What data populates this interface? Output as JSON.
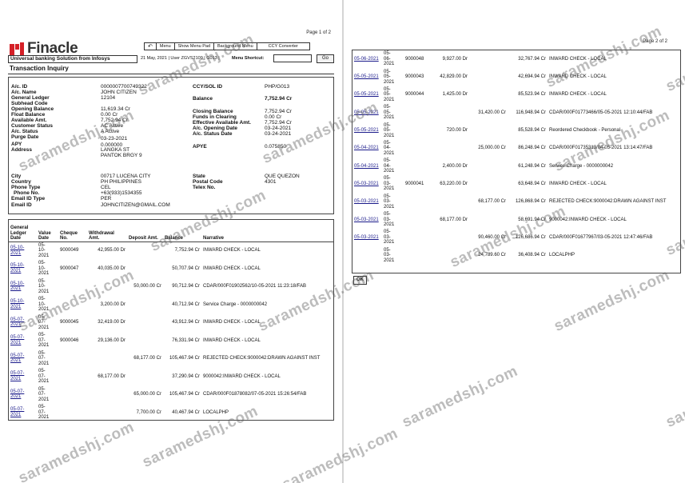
{
  "page1": {
    "page_number": "Page 1 of 2",
    "brand": "Finacle",
    "menu": [
      "Menu",
      "Show Menu Pad",
      "Background Menu",
      "CCY Converter"
    ],
    "menu_icon": "menu-pad-icon",
    "ubs_title": "Universal banking Solution from Infosys",
    "info_bar": "21 May, 2021 | User ZGVS2109 | G013 |",
    "shortcut_label": "Menu Shortcut:",
    "go_label": "Go",
    "page_title": "Transaction Inquiry",
    "account": {
      "left": [
        {
          "label": "A/c. ID",
          "value": "0000007700749322"
        },
        {
          "label": "A/c. Name",
          "value": "JOHN CITIZEN"
        },
        {
          "label": "General Ledger",
          "value": "12104"
        },
        {
          "label": "Subhead Code",
          "value": ""
        },
        {
          "label": "Opening Balance",
          "value": "11,619.34 Cr"
        },
        {
          "label": "Float Balance",
          "value": "0.00 Cr"
        },
        {
          "label": "Available Amt.",
          "value": "7,752.94 Cr"
        },
        {
          "label": "Customer Status",
          "value": "AC Active"
        },
        {
          "label": "A/c. Status",
          "value": "A Active"
        },
        {
          "label": "Purge Date",
          "value": "03-23-2021"
        },
        {
          "label": "APY",
          "value": "0.000000"
        },
        {
          "label": "Address",
          "value": "LANGKA ST"
        },
        {
          "label": "",
          "value": "PANTOK BRGY 9"
        }
      ],
      "right": [
        {
          "label": "CCY/SOL ID",
          "value": "PHP/G013"
        },
        {
          "label": "Balance",
          "value": "7,752.94 Cr"
        },
        {
          "label": "Closing Balance",
          "value": "7,752.94 Cr"
        },
        {
          "label": "Funds in Clearing",
          "value": "0.00 Cr"
        },
        {
          "label": "Effective Available Amt.",
          "value": "7,752.94 Cr"
        },
        {
          "label": "A/c. Opening Date",
          "value": "03-24-2021"
        },
        {
          "label": "A/c. Status Date",
          "value": "03-24-2021"
        },
        {
          "label": "APYE",
          "value": "0.075850"
        }
      ],
      "bottom_left": [
        {
          "label": "City",
          "value": "00717 LUCENA CITY"
        },
        {
          "label": "Country",
          "value": "PH PHILIPPINES"
        },
        {
          "label": "Phone Type",
          "value": "CEL"
        },
        {
          "label": "Phone No.",
          "value": "+63(933)1534355"
        },
        {
          "label": "Email ID Type",
          "value": "PER"
        },
        {
          "label": "Email ID",
          "value": "JOHNCITIZEN@GMAIL.COM"
        }
      ],
      "bottom_right": [
        {
          "label": "State",
          "value": "QUE QUEZON"
        },
        {
          "label": "Postal Code",
          "value": "4301"
        },
        {
          "label": "Telex No.",
          "value": ""
        }
      ]
    },
    "columns": [
      "General Ledger Date",
      "Value Date",
      "Cheque No.",
      "Withdrawal Amt.",
      "Deposit Amt.",
      "Balance",
      "Narrative"
    ],
    "rows": [
      {
        "gl": "05-10-2021",
        "vd": "05-10-2021",
        "chq": "9000049",
        "wd": "42,955.00 Dr",
        "dep": "",
        "bal": "7,752.94 Cr",
        "narr": "INWARD CHECK - LOCAL"
      },
      {
        "gl": "05-10-2021",
        "vd": "05-10-2021",
        "chq": "9000047",
        "wd": "40,035.00 Dr",
        "dep": "",
        "bal": "50,707.94 Cr",
        "narr": "INWARD CHECK - LOCAL"
      },
      {
        "gl": "05-10-2021",
        "vd": "05-10-2021",
        "chq": "",
        "wd": "",
        "dep": "50,000.00 Cr",
        "bal": "90,712.94 Cr",
        "narr": "CDAR/000F01902562/10-05-2021 11:23:18/FAB"
      },
      {
        "gl": "05-10-2021",
        "vd": "05-10-2021",
        "chq": "",
        "wd": "3,200.00 Dr",
        "dep": "",
        "bal": "40,712.94 Cr",
        "narr": "Service Charge - 0000000042"
      },
      {
        "gl": "05-07-2021",
        "vd": "05-07-2021",
        "chq": "9000045",
        "wd": "32,419.00 Dr",
        "dep": "",
        "bal": "43,912.94 Cr",
        "narr": "INWARD CHECK - LOCAL"
      },
      {
        "gl": "05-07-2021",
        "vd": "05-07-2021",
        "chq": "9000046",
        "wd": "29,136.00 Dr",
        "dep": "",
        "bal": "76,331.94 Cr",
        "narr": "INWARD CHECK - LOCAL"
      },
      {
        "gl": "05-07-2021",
        "vd": "05-07-2021",
        "chq": "",
        "wd": "",
        "dep": "68,177.00 Cr",
        "bal": "105,467.94 Cr",
        "narr": "REJECTED CHECK:9000042:DRAWN AGAINST INST"
      },
      {
        "gl": "05-07-2021",
        "vd": "05-07-2021",
        "chq": "",
        "wd": "68,177.00 Dr",
        "dep": "",
        "bal": "37,290.94 Cr",
        "narr": "9000042:INWARD CHECK - LOCAL"
      },
      {
        "gl": "05-07-2021",
        "vd": "05-07-2021",
        "chq": "",
        "wd": "",
        "dep": "65,000.00 Cr",
        "bal": "105,467.94 Cr",
        "narr": "CDAR/000F01878082/07-05-2021 15:26:54/FAB"
      },
      {
        "gl": "05-07-2021",
        "vd": "05-07-2021",
        "chq": "",
        "wd": "",
        "dep": "7,700.00 Cr",
        "bal": "40,467.94 Cr",
        "narr": "LOCALPHP"
      }
    ]
  },
  "page2": {
    "page_number": "Page 2 of 2",
    "rows": [
      {
        "gl": "05-06-2021",
        "vd": "05-06-2021",
        "chq": "9000048",
        "wd": "9,927.00 Dr",
        "dep": "",
        "bal": "32,767.94 Cr",
        "narr": "INWARD CHECK - LOCAL"
      },
      {
        "gl": "05-05-2021",
        "vd": "05-05-2021",
        "chq": "9000043",
        "wd": "42,829.00 Dr",
        "dep": "",
        "bal": "42,694.94 Cr",
        "narr": "INWARD CHECK - LOCAL"
      },
      {
        "gl": "05-05-2021",
        "vd": "05-05-2021",
        "chq": "9000044",
        "wd": "1,425.00 Dr",
        "dep": "",
        "bal": "85,523.94 Cr",
        "narr": "INWARD CHECK - LOCAL"
      },
      {
        "gl": "05-05-2021",
        "vd": "05-05-2021",
        "chq": "",
        "wd": "",
        "dep": "31,420.00 Cr",
        "bal": "116,948.94 Cr",
        "narr": "CDAR/000F01773466/05-05-2021 12:10:44/FAB"
      },
      {
        "gl": "05-05-2021",
        "vd": "05-05-2021",
        "chq": "",
        "wd": "720.00 Dr",
        "dep": "",
        "bal": "85,528.94 Cr",
        "narr": "Reordered Checkbook - Personal"
      },
      {
        "gl": "05-04-2021",
        "vd": "05-04-2021",
        "chq": "",
        "wd": "",
        "dep": "25,000.00 Cr",
        "bal": "86,248.94 Cr",
        "narr": "CDAR/000F01735313/04-05-2021 13:14:47/FAB"
      },
      {
        "gl": "05-04-2021",
        "vd": "05-04-2021",
        "chq": "",
        "wd": "2,400.00 Dr",
        "dep": "",
        "bal": "61,248.94 Cr",
        "narr": "Service Charge - 0000000042"
      },
      {
        "gl": "05-03-2021",
        "vd": "05-03-2021",
        "chq": "9000041",
        "wd": "63,220.00 Dr",
        "dep": "",
        "bal": "63,648.94 Cr",
        "narr": "INWARD CHECK - LOCAL"
      },
      {
        "gl": "05-03-2021",
        "vd": "05-03-2021",
        "chq": "",
        "wd": "",
        "dep": "68,177.00 Cr",
        "bal": "126,868.94 Cr",
        "narr": "REJECTED CHECK:9000042:DRAWN AGAINST INST"
      },
      {
        "gl": "05-03-2021",
        "vd": "05-03-2021",
        "chq": "",
        "wd": "68,177.00 Dr",
        "dep": "",
        "bal": "58,691.94 Cr",
        "narr": "9000042:INWARD CHECK - LOCAL"
      },
      {
        "gl": "05-03-2021",
        "vd": "05-03-2021",
        "chq": "",
        "wd": "",
        "dep": "90,460.00 Cr",
        "bal": "126,686.94 Cr",
        "narr": "CDAR/000F01677967/03-05-2021 12:47:46/FAB"
      },
      {
        "gl": "",
        "vd": "05-03-2021",
        "chq": "",
        "wd": "",
        "dep": "24,789.60 Cr",
        "bal": "36,408.94 Cr",
        "narr": "LOCALPHP"
      }
    ],
    "ok_label": "OK"
  },
  "watermark": "saramedshj.com"
}
